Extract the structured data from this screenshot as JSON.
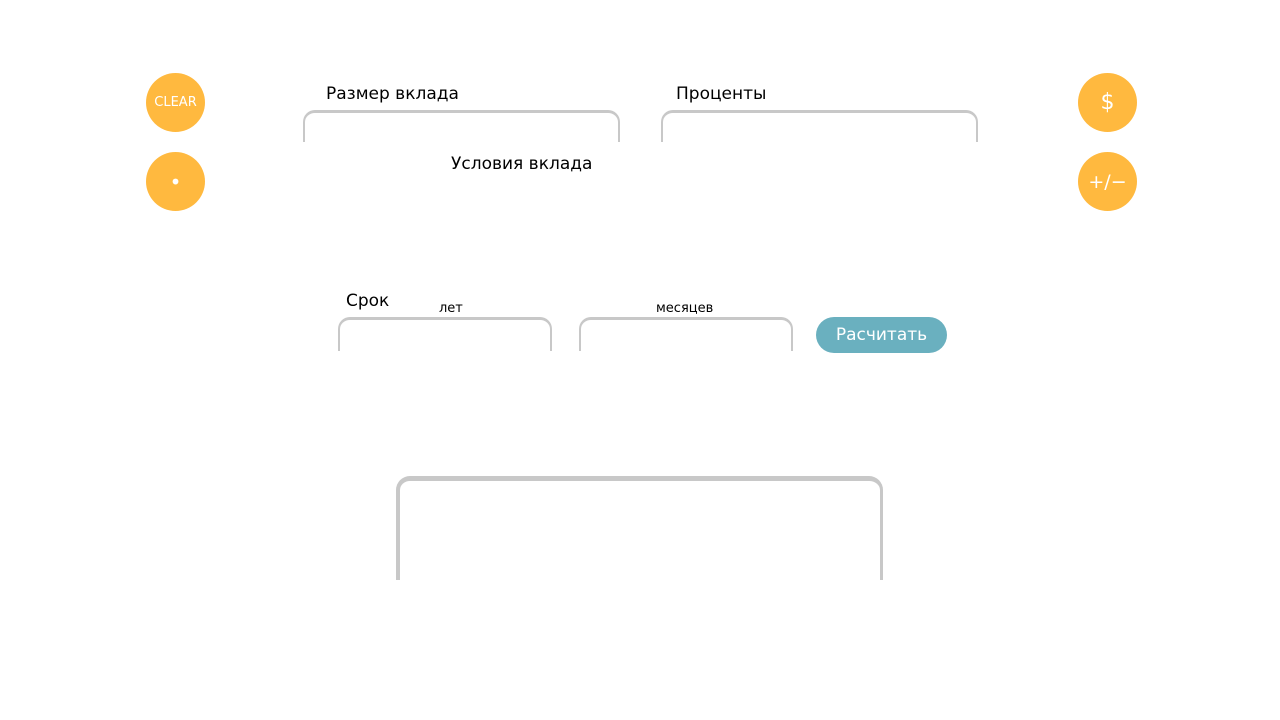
{
  "buttons": {
    "clear": "CLEAR",
    "dot": "•",
    "currency": "$",
    "sign": "+/−",
    "calculate": "Расчитать"
  },
  "labels": {
    "deposit_size": "Размер вклада",
    "percent": "Проценты",
    "conditions": "Условия вклада",
    "term": "Срок",
    "years": "лет",
    "months": "месяцев"
  },
  "fields": {
    "deposit_size": {
      "value": "",
      "placeholder": ""
    },
    "percent": {
      "value": "",
      "placeholder": ""
    },
    "years": {
      "value": "",
      "placeholder": ""
    },
    "months": {
      "value": "",
      "placeholder": ""
    }
  },
  "result": {
    "text": ""
  },
  "colors": {
    "accent_orange": "#ffb93f",
    "button_blue": "#6ab0bf",
    "field_border": "#c8c8c8"
  }
}
